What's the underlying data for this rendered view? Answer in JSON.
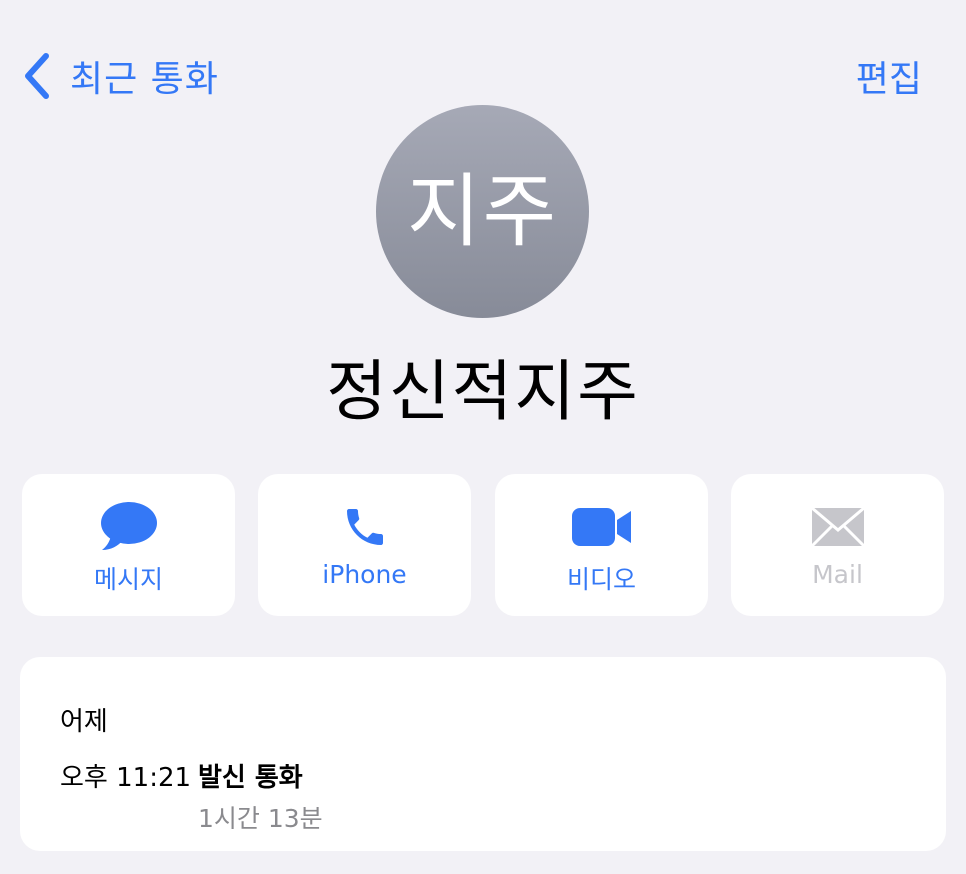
{
  "nav": {
    "back_label": "최근 통화",
    "edit_label": "편집"
  },
  "contact": {
    "avatar_initials": "지주",
    "name": "정신적지주"
  },
  "actions": [
    {
      "label": "메시지",
      "icon": "message-bubble-icon",
      "enabled": true
    },
    {
      "label": "iPhone",
      "icon": "phone-icon",
      "enabled": true
    },
    {
      "label": "비디오",
      "icon": "video-camera-icon",
      "enabled": true
    },
    {
      "label": "Mail",
      "icon": "envelope-icon",
      "enabled": false
    }
  ],
  "call_history": {
    "date": "어제",
    "entries": [
      {
        "time": "오후 11:21",
        "type": "발신 통화",
        "duration": "1시간 13분"
      }
    ]
  },
  "colors": {
    "accent": "#3478f6",
    "background": "#f2f1f6",
    "card": "#ffffff",
    "disabled": "#c6c6cb",
    "secondary_text": "#8a8a8e"
  }
}
